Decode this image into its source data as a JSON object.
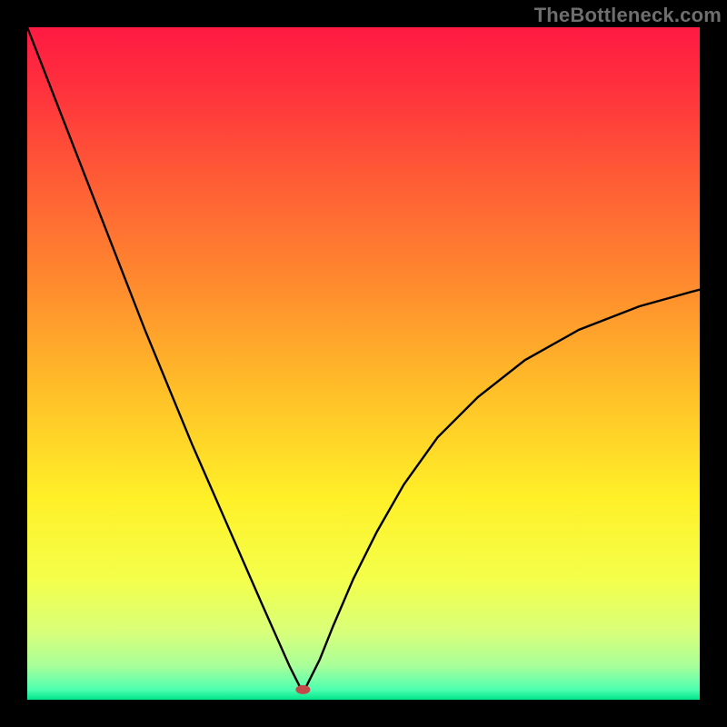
{
  "watermark": "TheBottleneck.com",
  "chart_data": {
    "type": "line",
    "title": "",
    "xlabel": "",
    "ylabel": "",
    "xlim": [
      0,
      100
    ],
    "ylim": [
      0,
      100
    ],
    "background_gradient": {
      "stops": [
        {
          "offset": 0.0,
          "color": "#ff1a42"
        },
        {
          "offset": 0.08,
          "color": "#ff2e3e"
        },
        {
          "offset": 0.22,
          "color": "#ff5a36"
        },
        {
          "offset": 0.38,
          "color": "#ff8a2e"
        },
        {
          "offset": 0.55,
          "color": "#ffc228"
        },
        {
          "offset": 0.7,
          "color": "#fff028"
        },
        {
          "offset": 0.82,
          "color": "#f4ff4a"
        },
        {
          "offset": 0.9,
          "color": "#d8ff7a"
        },
        {
          "offset": 0.95,
          "color": "#a8ff9a"
        },
        {
          "offset": 0.985,
          "color": "#4dffb0"
        },
        {
          "offset": 1.0,
          "color": "#00e58a"
        }
      ]
    },
    "series": [
      {
        "name": "bottleneck-curve",
        "color": "#000000",
        "x": [
          0.0,
          3.5,
          7.0,
          10.5,
          14.0,
          17.5,
          21.0,
          24.5,
          28.0,
          31.5,
          35.0,
          37.0,
          39.0,
          40.0,
          40.5,
          41.0,
          41.5,
          42.0,
          43.5,
          45.5,
          48.5,
          52.0,
          56.0,
          61.0,
          67.0,
          74.0,
          82.0,
          91.0,
          100.0
        ],
        "y": [
          100.0,
          91.0,
          82.0,
          73.0,
          64.0,
          55.0,
          46.5,
          38.0,
          30.0,
          22.0,
          14.0,
          9.5,
          5.0,
          3.0,
          2.0,
          1.5,
          2.0,
          3.0,
          6.0,
          11.0,
          18.0,
          25.0,
          32.0,
          39.0,
          45.0,
          50.5,
          55.0,
          58.5,
          61.0
        ]
      }
    ],
    "marker": {
      "name": "min-point",
      "x": 41.0,
      "y": 1.5,
      "color": "#c34a4a",
      "rx": 8,
      "ry": 5
    }
  }
}
